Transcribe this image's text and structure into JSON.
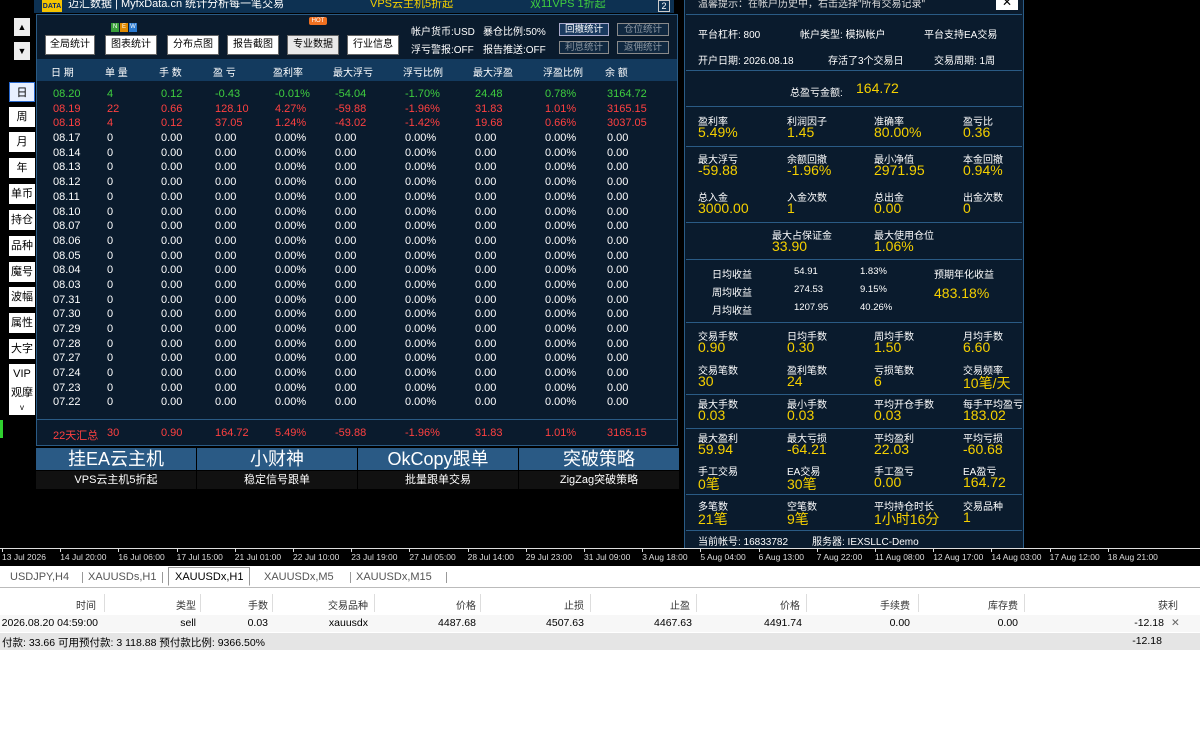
{
  "colors": {
    "green": "#3fcf3f",
    "red": "#ff4040",
    "white": "#ffffff",
    "yellow": "#f5d000",
    "panel": "#0a1b2d",
    "header": "#133a5e"
  },
  "topbar": {
    "logo": "DATA",
    "title": "迈汇数据 | MyfxData.cn  统计分析每一笔交易",
    "vps": "VPS云主机5折起",
    "vps2": "双11VPS 1折起",
    "btn2": "2"
  },
  "left": {
    "up": "▲",
    "down": "▼",
    "buttons": [
      "日",
      "周",
      "月",
      "年",
      "单币",
      "持仓",
      "品种",
      "魔号",
      "波幅",
      "属性",
      "大字",
      "VIP",
      "观摩"
    ],
    "more": "v"
  },
  "toolbar": {
    "buttons": [
      "全局统计",
      "图表统计",
      "分布点图",
      "报告截图",
      "专业数据",
      "行业信息"
    ],
    "hot": "HOT",
    "new": [
      "N",
      "E",
      "W"
    ],
    "currency": "帐户货币:USD",
    "ratio": "暴仓比例:50%",
    "warn": "浮亏警报:OFF",
    "push": "报告推送:OFF",
    "small": [
      "回撤统计",
      "仓位统计",
      "利息统计",
      "返佣统计"
    ]
  },
  "table": {
    "headers": [
      "日 期",
      "单 量",
      "手 数",
      "盈 亏",
      "盈利率",
      "最大浮亏",
      "浮亏比例",
      "最大浮盈",
      "浮盈比例",
      "余 额"
    ],
    "rows": [
      [
        "08.20",
        "4",
        "0.12",
        "-0.43",
        "-0.01%",
        "-54.04",
        "-1.70%",
        "24.48",
        "0.78%",
        "3164.72"
      ],
      [
        "08.19",
        "22",
        "0.66",
        "128.10",
        "4.27%",
        "-59.88",
        "-1.96%",
        "31.83",
        "1.01%",
        "3165.15"
      ],
      [
        "08.18",
        "4",
        "0.12",
        "37.05",
        "1.24%",
        "-43.02",
        "-1.42%",
        "19.68",
        "0.66%",
        "3037.05"
      ],
      [
        "08.17",
        "0",
        "0.00",
        "0.00",
        "0.00%",
        "0.00",
        "0.00%",
        "0.00",
        "0.00%",
        "0.00"
      ],
      [
        "08.14",
        "0",
        "0.00",
        "0.00",
        "0.00%",
        "0.00",
        "0.00%",
        "0.00",
        "0.00%",
        "0.00"
      ],
      [
        "08.13",
        "0",
        "0.00",
        "0.00",
        "0.00%",
        "0.00",
        "0.00%",
        "0.00",
        "0.00%",
        "0.00"
      ],
      [
        "08.12",
        "0",
        "0.00",
        "0.00",
        "0.00%",
        "0.00",
        "0.00%",
        "0.00",
        "0.00%",
        "0.00"
      ],
      [
        "08.11",
        "0",
        "0.00",
        "0.00",
        "0.00%",
        "0.00",
        "0.00%",
        "0.00",
        "0.00%",
        "0.00"
      ],
      [
        "08.10",
        "0",
        "0.00",
        "0.00",
        "0.00%",
        "0.00",
        "0.00%",
        "0.00",
        "0.00%",
        "0.00"
      ],
      [
        "08.07",
        "0",
        "0.00",
        "0.00",
        "0.00%",
        "0.00",
        "0.00%",
        "0.00",
        "0.00%",
        "0.00"
      ],
      [
        "08.06",
        "0",
        "0.00",
        "0.00",
        "0.00%",
        "0.00",
        "0.00%",
        "0.00",
        "0.00%",
        "0.00"
      ],
      [
        "08.05",
        "0",
        "0.00",
        "0.00",
        "0.00%",
        "0.00",
        "0.00%",
        "0.00",
        "0.00%",
        "0.00"
      ],
      [
        "08.04",
        "0",
        "0.00",
        "0.00",
        "0.00%",
        "0.00",
        "0.00%",
        "0.00",
        "0.00%",
        "0.00"
      ],
      [
        "08.03",
        "0",
        "0.00",
        "0.00",
        "0.00%",
        "0.00",
        "0.00%",
        "0.00",
        "0.00%",
        "0.00"
      ],
      [
        "07.31",
        "0",
        "0.00",
        "0.00",
        "0.00%",
        "0.00",
        "0.00%",
        "0.00",
        "0.00%",
        "0.00"
      ],
      [
        "07.30",
        "0",
        "0.00",
        "0.00",
        "0.00%",
        "0.00",
        "0.00%",
        "0.00",
        "0.00%",
        "0.00"
      ],
      [
        "07.29",
        "0",
        "0.00",
        "0.00",
        "0.00%",
        "0.00",
        "0.00%",
        "0.00",
        "0.00%",
        "0.00"
      ],
      [
        "07.28",
        "0",
        "0.00",
        "0.00",
        "0.00%",
        "0.00",
        "0.00%",
        "0.00",
        "0.00%",
        "0.00"
      ],
      [
        "07.27",
        "0",
        "0.00",
        "0.00",
        "0.00%",
        "0.00",
        "0.00%",
        "0.00",
        "0.00%",
        "0.00"
      ],
      [
        "07.24",
        "0",
        "0.00",
        "0.00",
        "0.00%",
        "0.00",
        "0.00%",
        "0.00",
        "0.00%",
        "0.00"
      ],
      [
        "07.23",
        "0",
        "0.00",
        "0.00",
        "0.00%",
        "0.00",
        "0.00%",
        "0.00",
        "0.00%",
        "0.00"
      ],
      [
        "07.22",
        "0",
        "0.00",
        "0.00",
        "0.00%",
        "0.00",
        "0.00%",
        "0.00",
        "0.00%",
        "0.00"
      ]
    ],
    "row_colors": [
      "green",
      "red",
      "red",
      "white",
      "white",
      "white",
      "white",
      "white",
      "white",
      "white",
      "white",
      "white",
      "white",
      "white",
      "white",
      "white",
      "white",
      "white",
      "white",
      "white",
      "white",
      "white"
    ],
    "summary": [
      "22天汇总",
      "30",
      "0.90",
      "164.72",
      "5.49%",
      "-59.88",
      "-1.96%",
      "31.83",
      "1.01%",
      "3165.15"
    ]
  },
  "promos": [
    {
      "big": "挂EA云主机",
      "small": "VPS云主机5折起"
    },
    {
      "big": "小财神",
      "small": "稳定信号跟单"
    },
    {
      "big": "OkCopy跟单",
      "small": "批量跟单交易"
    },
    {
      "big": "突破策略",
      "small": "ZigZag突破策略"
    }
  ],
  "right": {
    "notice": "温馨提示：在帐户历史中，右击选择\"所有交易记录\"",
    "close": "✕",
    "leverage": "平台杠杆:  800",
    "acctype": "帐户类型:  模拟帐户",
    "platform": "平台支持EA交易",
    "opendate": "开户日期:  2026.08.18",
    "alive": "存活了3个交易日",
    "period": "交易周期:  1周",
    "total_label": "总盈亏金额:",
    "total_value": "164.72",
    "stats1": [
      [
        "盈利率",
        "5.49%"
      ],
      [
        "利润因子",
        "1.45"
      ],
      [
        "准确率",
        "80.00%"
      ],
      [
        "盈亏比",
        "0.36"
      ]
    ],
    "stats2": [
      [
        "最大浮亏",
        "-59.88"
      ],
      [
        "余额回撤",
        "-1.96%"
      ],
      [
        "最小净值",
        "2971.95"
      ],
      [
        "本金回撤",
        "0.94%"
      ]
    ],
    "stats3": [
      [
        "总入金",
        "3000.00"
      ],
      [
        "入金次数",
        "1"
      ],
      [
        "总出金",
        "0.00"
      ],
      [
        "出金次数",
        "0"
      ]
    ],
    "stats4": [
      [
        "最大占保证金",
        "33.90"
      ],
      [
        "最大使用仓位",
        "1.06%"
      ]
    ],
    "daily": [
      [
        "日均收益",
        "54.91",
        "1.83%"
      ],
      [
        "周均收益",
        "274.53",
        "9.15%"
      ],
      [
        "月均收益",
        "1207.95",
        "40.26%"
      ]
    ],
    "annual_label": "预期年化收益",
    "annual_value": "483.18%",
    "stats5": [
      [
        "交易手数",
        "0.90"
      ],
      [
        "日均手数",
        "0.30"
      ],
      [
        "周均手数",
        "1.50"
      ],
      [
        "月均手数",
        "6.60"
      ]
    ],
    "stats6": [
      [
        "交易笔数",
        "30"
      ],
      [
        "盈利笔数",
        "24"
      ],
      [
        "亏损笔数",
        "6"
      ],
      [
        "交易频率",
        "10笔/天"
      ]
    ],
    "stats7": [
      [
        "最大手数",
        "0.03"
      ],
      [
        "最小手数",
        "0.03"
      ],
      [
        "平均开仓手数",
        "0.03"
      ],
      [
        "每手平均盈亏",
        "183.02"
      ]
    ],
    "stats8": [
      [
        "最大盈利",
        "59.94"
      ],
      [
        "最大亏损",
        "-64.21"
      ],
      [
        "平均盈利",
        "22.03"
      ],
      [
        "平均亏损",
        "-60.68"
      ]
    ],
    "stats9": [
      [
        "手工交易",
        "0笔"
      ],
      [
        "EA交易",
        "30笔"
      ],
      [
        "手工盈亏",
        "0.00"
      ],
      [
        "EA盈亏",
        "164.72"
      ]
    ],
    "stats10": [
      [
        "多笔数",
        "21笔"
      ],
      [
        "空笔数",
        "9笔"
      ],
      [
        "平均持仓时长",
        "1小时16分"
      ],
      [
        "交易品种",
        "1"
      ]
    ],
    "account": "当前帐号:  16833782",
    "server": "服务器:  IEXSLLC-Demo"
  },
  "timeaxis": [
    "13 Jul 2026",
    "14 Jul 20:00",
    "16 Jul 06:00",
    "17 Jul 15:00",
    "21 Jul 01:00",
    "22 Jul 10:00",
    "23 Jul 19:00",
    "27 Jul 05:00",
    "28 Jul 14:00",
    "29 Jul 23:00",
    "31 Jul 09:00",
    "3 Aug 18:00",
    "5 Aug 04:00",
    "6 Aug 13:00",
    "7 Aug 22:00",
    "11 Aug 08:00",
    "12 Aug 17:00",
    "14 Aug 03:00",
    "17 Aug 12:00",
    "18 Aug 21:00"
  ],
  "tabs": [
    "USDJPY,H4",
    "XAUUSDs,H1",
    "XAUUSDx,H1",
    "XAUUSDx,M5",
    "XAUUSDx,M15"
  ],
  "active_tab": "XAUUSDx,H1",
  "terminal": {
    "headers": [
      "时间",
      "类型",
      "手数",
      "交易品种",
      "价格",
      "止损",
      "止盈",
      "价格",
      "手续费",
      "库存费",
      "获利"
    ],
    "row": [
      "2026.08.20 04:59:00",
      "sell",
      "0.03",
      "xauusdx",
      "4487.68",
      "4507.63",
      "4467.63",
      "4491.74",
      "0.00",
      "0.00",
      "-12.18"
    ],
    "row_close": "✕",
    "summary": "付款: 33.66  可用预付款: 3 118.88  预付款比例: 9366.50%",
    "summary_profit": "-12.18"
  }
}
